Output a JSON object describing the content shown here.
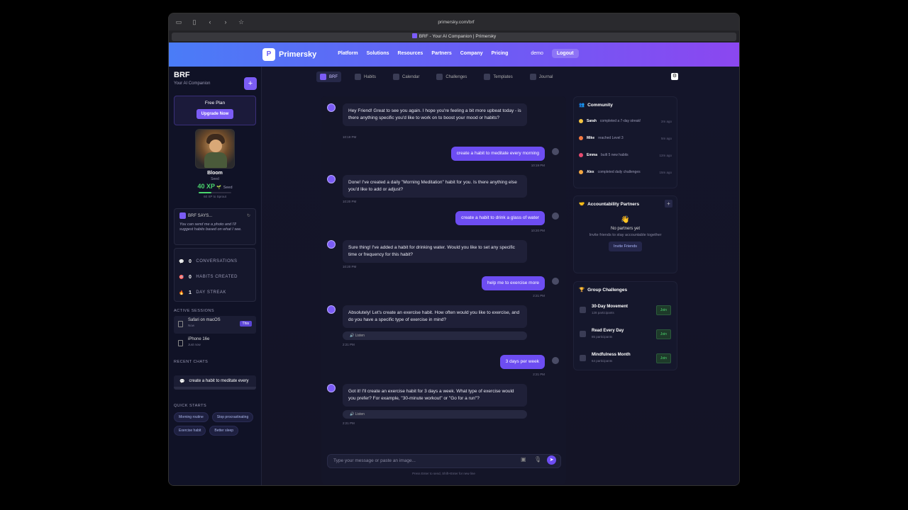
{
  "browser": {
    "url": "primersky.com/brf",
    "tab_title": "BRF - Your AI Companion | Primersky"
  },
  "header": {
    "brand": "Primersky",
    "nav": [
      "Platform",
      "Solutions",
      "Resources",
      "Partners",
      "Company",
      "Pricing"
    ],
    "user": "demo",
    "logout": "Logout"
  },
  "sidebar": {
    "title": "BRF",
    "subtitle": "Your AI Companion",
    "plan": {
      "label": "Free Plan",
      "button": "Upgrade Now"
    },
    "pet": {
      "name": "Bloom",
      "stage": "Seed",
      "xp": "40 XP",
      "xp_stage": "Seed",
      "next": "60 XP to Sprout",
      "progress": 0.4
    },
    "says": {
      "title": "BRF SAYS...",
      "text": "You can send me a photo and I'll suggest habits based on what I see."
    },
    "stats": [
      {
        "value": "0",
        "label": "CONVERSATIONS"
      },
      {
        "value": "0",
        "label": "HABITS CREATED"
      },
      {
        "value": "1",
        "label": "DAY STREAK"
      }
    ],
    "active_sessions_label": "ACTIVE SESSIONS",
    "sessions": [
      {
        "name": "Safari on macOS",
        "time": "Now",
        "badge": "This"
      },
      {
        "name": "iPhone 16e",
        "time": "Just now"
      }
    ],
    "recent_label": "RECENT CHATS",
    "recent": "create a habit to meditate every",
    "quick_label": "QUICK STARTS",
    "quick": [
      "Morning routine",
      "Stop procrastinating",
      "Exercise habit",
      "Better sleep"
    ]
  },
  "tooltabs": [
    "BRF",
    "Habits",
    "Calendar",
    "Challenges",
    "Templates",
    "Journal"
  ],
  "chat": {
    "messages": [
      {
        "role": "bot",
        "text": "Hey Friend! Great to see you again. I hope you're feeling a bit more upbeat today - is there anything specific you'd like to work on to boost your mood or habits?",
        "time": "10:19 PM"
      },
      {
        "role": "user",
        "text": "create a habit to meditate every morning",
        "time": "10:19 PM"
      },
      {
        "role": "bot",
        "text": "Done! I've created a daily \"Morning Meditation\" habit for you. Is there anything else you'd like to add or adjust?",
        "time": "10:20 PM"
      },
      {
        "role": "user",
        "text": "create a habit to drink a glass of water",
        "time": "10:20 PM"
      },
      {
        "role": "bot",
        "text": "Sure thing! I've added a habit for drinking water. Would you like to set any specific time or frequency for this habit?",
        "time": "10:20 PM"
      },
      {
        "role": "user",
        "text": "help me to exercise more",
        "time": "2:21 PM"
      },
      {
        "role": "bot",
        "text": "Absolutely! Let's create an exercise habit. How often would you like to exercise, and do you have a specific type of exercise in mind?",
        "time": "2:21 PM",
        "listen": "Listen"
      },
      {
        "role": "user",
        "text": "3 days per week",
        "time": "2:21 PM"
      },
      {
        "role": "bot",
        "text": "Got it! I'll create an exercise habit for 3 days a week. What type of exercise would you prefer? For example, \"30-minute workout\" or \"Go for a run\"?",
        "time": "2:21 PM",
        "listen": "Listen"
      }
    ],
    "placeholder": "Type your message or paste an image...",
    "hint": "Press Enter to send, Shift+Enter for new line"
  },
  "community": {
    "title": "Community",
    "items": [
      {
        "name": "Sarah",
        "action": "completed a 7-day streak!",
        "ago": "2m ago",
        "color": "#f5c542"
      },
      {
        "name": "Mike",
        "action": "reached Level 3",
        "ago": "5m ago",
        "color": "#f57a42"
      },
      {
        "name": "Emma",
        "action": "built 5 new habits",
        "ago": "12m ago",
        "color": "#e84a6f"
      },
      {
        "name": "Alex",
        "action": "completed daily challenges",
        "ago": "15m ago",
        "color": "#f5a742"
      }
    ]
  },
  "partners": {
    "title": "Accountability Partners",
    "empty_title": "No partners yet",
    "empty_text": "Invite friends to stay accountable together",
    "button": "Invite Friends"
  },
  "challenges": {
    "title": "Group Challenges",
    "items": [
      {
        "name": "30-Day Movement",
        "participants": "128 participants",
        "button": "Join"
      },
      {
        "name": "Read Every Day",
        "participants": "85 participants",
        "button": "Join"
      },
      {
        "name": "Mindfulness Month",
        "participants": "64 participants",
        "button": "Join"
      }
    ]
  }
}
